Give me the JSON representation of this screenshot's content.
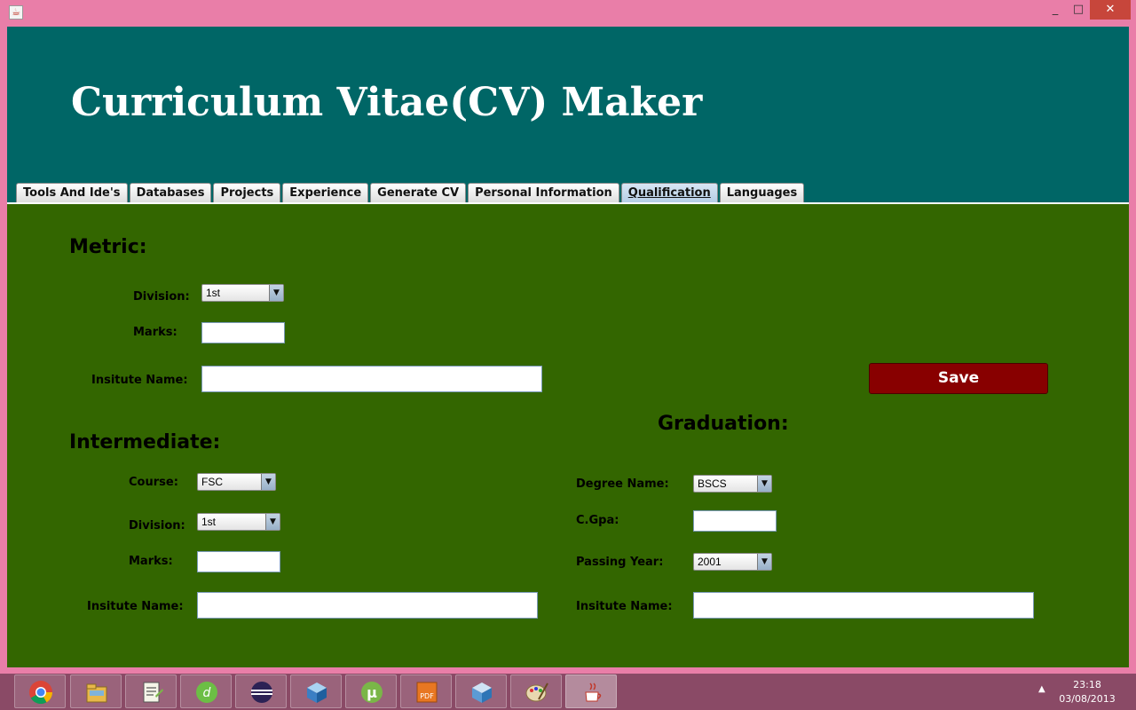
{
  "window": {
    "minimize_glyph": "_",
    "maximize_glyph": "□",
    "close_glyph": "✕"
  },
  "header": {
    "title": "Curriculum Vitae(CV) Maker"
  },
  "tabs": [
    {
      "label": "Tools And Ide's"
    },
    {
      "label": "Databases"
    },
    {
      "label": "Projects"
    },
    {
      "label": "Experience"
    },
    {
      "label": "Generate CV"
    },
    {
      "label": "Personal Information"
    },
    {
      "label": "Qualification",
      "active": true
    },
    {
      "label": "Languages"
    }
  ],
  "metric": {
    "title": "Metric:",
    "division_label": "Division:",
    "division_value": "1st",
    "marks_label": "Marks:",
    "marks_value": "",
    "institute_label": "Insitute Name:",
    "institute_value": ""
  },
  "save_label": "Save",
  "intermediate": {
    "title": "Intermediate:",
    "course_label": "Course:",
    "course_value": "FSC",
    "division_label": "Division:",
    "division_value": "1st",
    "marks_label": "Marks:",
    "marks_value": "",
    "institute_label": "Insitute Name:",
    "institute_value": ""
  },
  "graduation": {
    "title": "Graduation:",
    "degree_label": "Degree Name:",
    "degree_value": "BSCS",
    "cgpa_label": "C.Gpa:",
    "cgpa_value": "",
    "passing_year_label": "Passing Year:",
    "passing_year_value": "2001",
    "institute_label": "Insitute Name:",
    "institute_value": ""
  },
  "taskbar": {
    "apps": [
      {
        "icon": "chrome-icon"
      },
      {
        "icon": "file-explorer-icon"
      },
      {
        "icon": "notepad-plus-plus-icon"
      },
      {
        "icon": "dreamweaver-icon"
      },
      {
        "icon": "eclipse-icon"
      },
      {
        "icon": "netbeans-cube-icon"
      },
      {
        "icon": "utorrent-icon"
      },
      {
        "icon": "pdf-icon"
      },
      {
        "icon": "virtualbox-cube-icon"
      },
      {
        "icon": "paint-icon"
      },
      {
        "icon": "java-icon",
        "active": true
      }
    ],
    "time": "23:18",
    "date": "03/08/2013"
  },
  "colors": {
    "header_bg": "#006666",
    "content_bg": "#336600",
    "frame": "#e97ea8",
    "save_button": "#880000",
    "taskbar": "#8a4a66"
  }
}
